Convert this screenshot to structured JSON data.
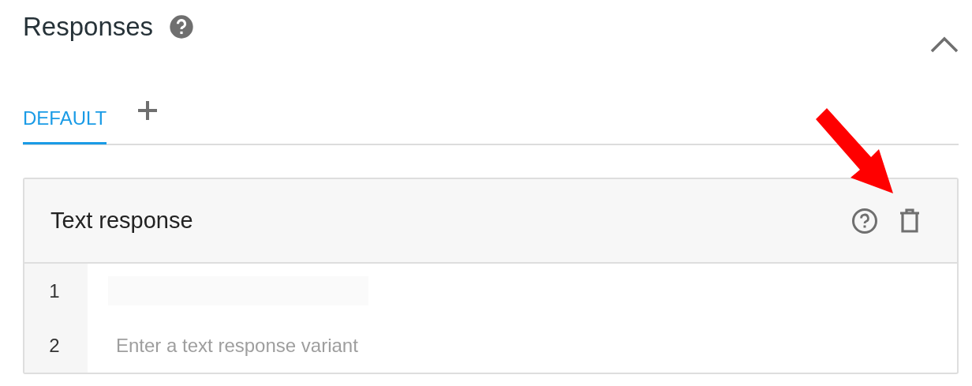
{
  "section": {
    "title": "Responses",
    "expanded": true
  },
  "tabs": [
    {
      "label": "DEFAULT",
      "selected": true
    }
  ],
  "card": {
    "title": "Text response",
    "rows": [
      {
        "number": "1",
        "kind": "redacted"
      },
      {
        "number": "2",
        "kind": "empty",
        "placeholder": "Enter a text response variant"
      }
    ]
  }
}
